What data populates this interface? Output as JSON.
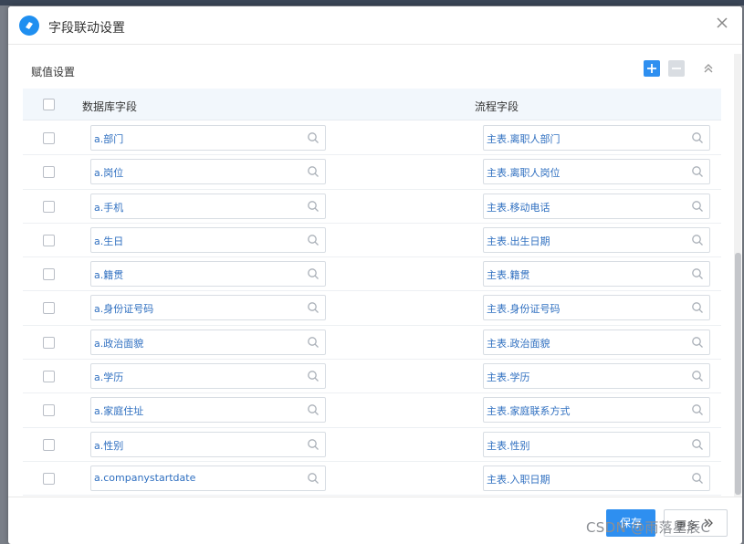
{
  "dialog": {
    "title": "字段联动设置"
  },
  "section": {
    "title": "赋值设置"
  },
  "table": {
    "columns": {
      "db_field": "数据库字段",
      "flow_field": "流程字段"
    },
    "rows": [
      {
        "db": "a.部门",
        "flow": "主表.离职人部门"
      },
      {
        "db": "a.岗位",
        "flow": "主表.离职人岗位"
      },
      {
        "db": "a.手机",
        "flow": "主表.移动电话"
      },
      {
        "db": "a.生日",
        "flow": "主表.出生日期"
      },
      {
        "db": "a.籍贯",
        "flow": "主表.籍贯"
      },
      {
        "db": "a.身份证号码",
        "flow": "主表.身份证号码"
      },
      {
        "db": "a.政治面貌",
        "flow": "主表.政治面貌"
      },
      {
        "db": "a.学历",
        "flow": "主表.学历"
      },
      {
        "db": "a.家庭住址",
        "flow": "主表.家庭联系方式"
      },
      {
        "db": "a.性别",
        "flow": "主表.性别"
      },
      {
        "db": "a.companystartdate",
        "flow": "主表.入职日期"
      }
    ]
  },
  "footer": {
    "save_label": "保存",
    "more_label": "更多"
  },
  "watermark": "CSDN @雨落星辰C",
  "icons": {
    "logo": "app-logo-icon",
    "close": "close-icon",
    "add": "plus-icon",
    "remove": "minus-icon",
    "collapse": "chevron-up-icon",
    "search": "search-icon",
    "more": "chevron-right-icon"
  },
  "colors": {
    "primary": "#2e8ff0",
    "value_text": "#2f6fc0",
    "header_bg": "#f2f7fc"
  }
}
